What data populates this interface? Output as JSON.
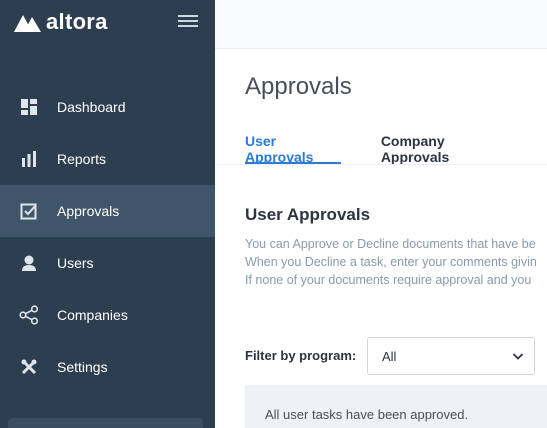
{
  "brand": {
    "name": "altora",
    "logo_icon": "altora-logo-icon"
  },
  "sidebar": {
    "menu_icon": "hamburger-menu-icon",
    "items": [
      {
        "label": "Dashboard",
        "icon": "dashboard-icon",
        "active": false
      },
      {
        "label": "Reports",
        "icon": "bar-chart-icon",
        "active": false
      },
      {
        "label": "Approvals",
        "icon": "checkbox-icon",
        "active": true
      },
      {
        "label": "Users",
        "icon": "user-icon",
        "active": false
      },
      {
        "label": "Companies",
        "icon": "share-nodes-icon",
        "active": false
      },
      {
        "label": "Settings",
        "icon": "tools-icon",
        "active": false
      }
    ]
  },
  "page": {
    "title": "Approvals",
    "tabs": [
      {
        "label": "User Approvals",
        "active": true
      },
      {
        "label": "Company Approvals",
        "active": false
      }
    ]
  },
  "section": {
    "title": "User Approvals",
    "description_lines": [
      "You can Approve or Decline documents that have be",
      "When you Decline a task, enter your comments givin",
      "If none of your documents require approval and you"
    ]
  },
  "filter": {
    "label": "Filter by program:",
    "selected": "All"
  },
  "notice": {
    "text": "All user tasks have been approved."
  },
  "colors": {
    "sidebar_bg": "#2d3e50",
    "sidebar_active": "#3f5569",
    "accent": "#2e7bd6",
    "muted_text": "#8a9aad"
  }
}
